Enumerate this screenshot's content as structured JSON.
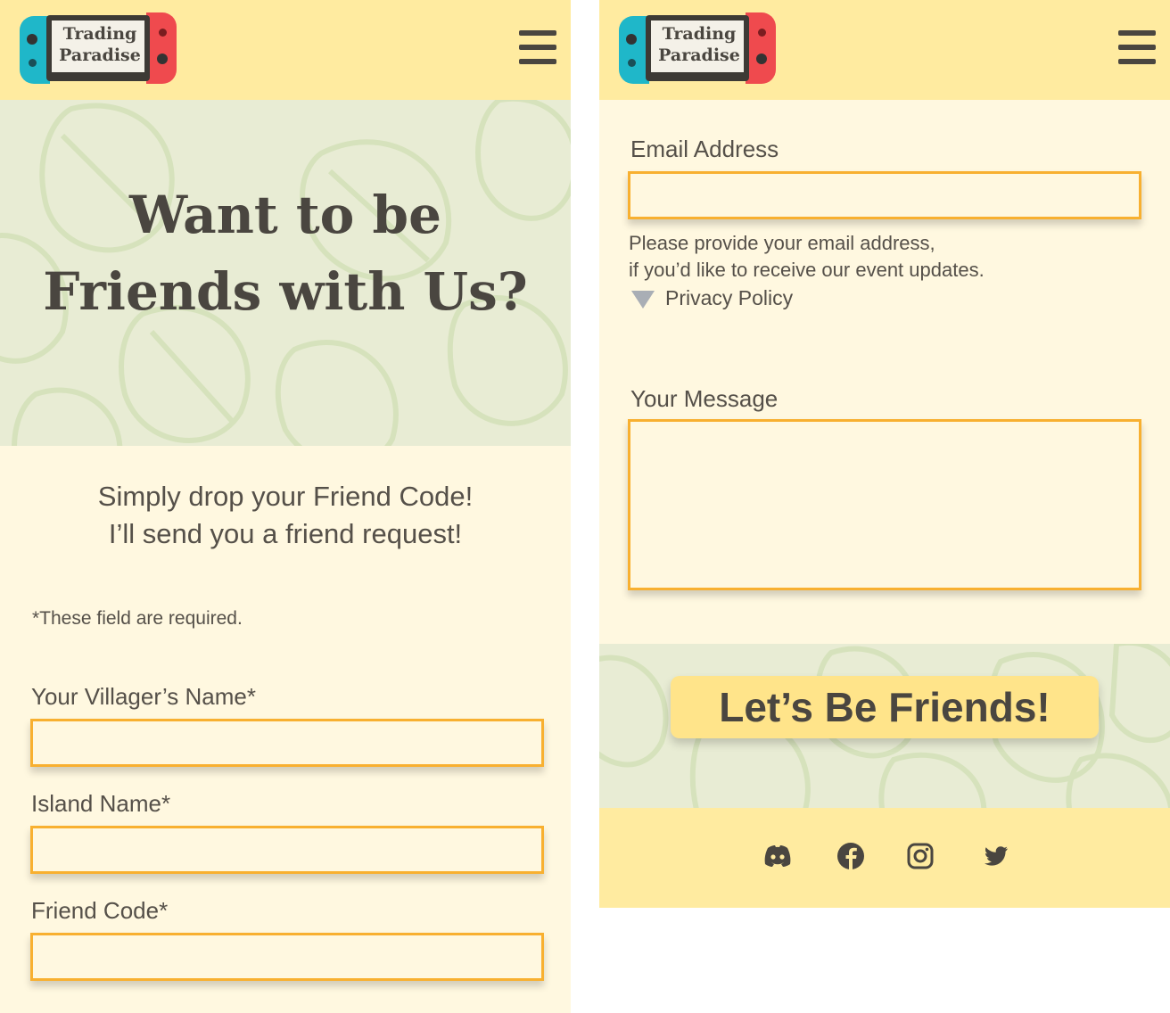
{
  "header": {
    "logo_line1": "Trading",
    "logo_line2": "Paradise",
    "menu_icon": "hamburger-menu-icon"
  },
  "hero": {
    "title_line1": "Want to be",
    "title_line2": "Friends with Us?"
  },
  "intro": {
    "line1": "Simply drop your Friend Code!",
    "line2": "I’ll send you a friend request!"
  },
  "form": {
    "required_note": "*These  field are required.",
    "villager_name_label": "Your Villager’s Name*",
    "villager_name_value": "",
    "island_name_label": "Island Name*",
    "island_name_value": "",
    "friend_code_label": "Friend Code*",
    "friend_code_value": "",
    "email_label": "Email Address",
    "email_value": "",
    "email_help_line1": "Please provide your email address,",
    "email_help_line2": "if you’d like to receive our event updates.",
    "privacy_label": "Privacy Policy",
    "message_label": "Your Message",
    "message_value": "",
    "submit_label": "Let’s Be Friends!"
  },
  "footer": {
    "social_icons": [
      "discord-icon",
      "facebook-icon",
      "instagram-icon",
      "twitter-icon"
    ]
  },
  "colors": {
    "header_bg": "#ffeba0",
    "page_bg": "#fff8e0",
    "pattern_bg": "#e8ecd4",
    "field_border": "#f8b030",
    "button_bg": "#ffe48a",
    "text": "#555049",
    "joycon_left": "#1fb7c9",
    "joycon_right": "#ef4a4e"
  }
}
